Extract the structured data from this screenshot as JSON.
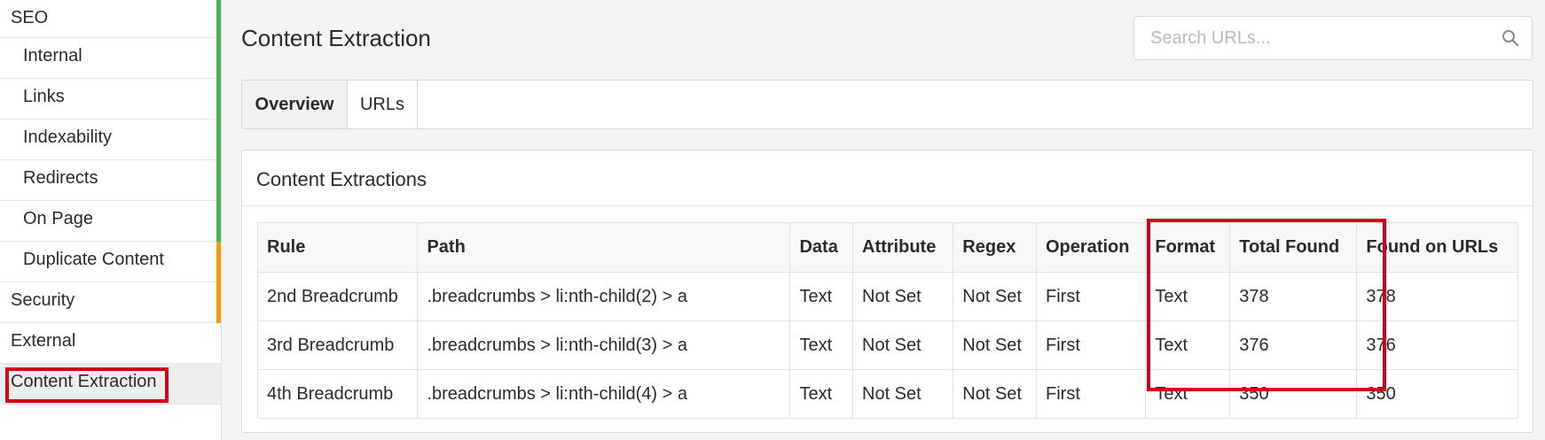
{
  "sidebar": {
    "items": [
      {
        "label": "SEO",
        "level": "top",
        "accent": "#4caf50"
      },
      {
        "label": "Internal",
        "level": "sub",
        "accent": "#4caf50"
      },
      {
        "label": "Links",
        "level": "sub",
        "accent": "#4caf50"
      },
      {
        "label": "Indexability",
        "level": "sub",
        "accent": "#4caf50"
      },
      {
        "label": "Redirects",
        "level": "sub",
        "accent": "#4caf50"
      },
      {
        "label": "On Page",
        "level": "sub",
        "accent": "#4caf50"
      },
      {
        "label": "Duplicate Content",
        "level": "sub",
        "accent": "#f39c12"
      },
      {
        "label": "Security",
        "level": "top",
        "accent": "#f39c12"
      },
      {
        "label": "External",
        "level": "top",
        "accent": null
      },
      {
        "label": "Content Extraction",
        "level": "top",
        "accent": null,
        "active": true
      }
    ]
  },
  "header": {
    "title": "Content Extraction",
    "search_placeholder": "Search URLs...",
    "search_value": ""
  },
  "tabs": [
    {
      "label": "Overview",
      "active": true
    },
    {
      "label": "URLs",
      "active": false
    }
  ],
  "panel": {
    "title": "Content Extractions",
    "columns": [
      "Rule",
      "Path",
      "Data",
      "Attribute",
      "Regex",
      "Operation",
      "Format",
      "Total Found",
      "Found on URLs"
    ],
    "rows": [
      [
        "2nd Breadcrumb",
        ".breadcrumbs > li:nth-child(2) > a",
        "Text",
        "Not Set",
        "Not Set",
        "First",
        "Text",
        "378",
        "378"
      ],
      [
        "3rd Breadcrumb",
        ".breadcrumbs > li:nth-child(3) > a",
        "Text",
        "Not Set",
        "Not Set",
        "First",
        "Text",
        "376",
        "376"
      ],
      [
        "4th Breadcrumb",
        ".breadcrumbs > li:nth-child(4) > a",
        "Text",
        "Not Set",
        "Not Set",
        "First",
        "Text",
        "350",
        "350"
      ]
    ]
  },
  "colors": {
    "seo_green": "#4caf50",
    "warning_orange": "#f39c12",
    "highlight_red": "#d0021b"
  },
  "icons": {
    "search": "search-icon"
  }
}
